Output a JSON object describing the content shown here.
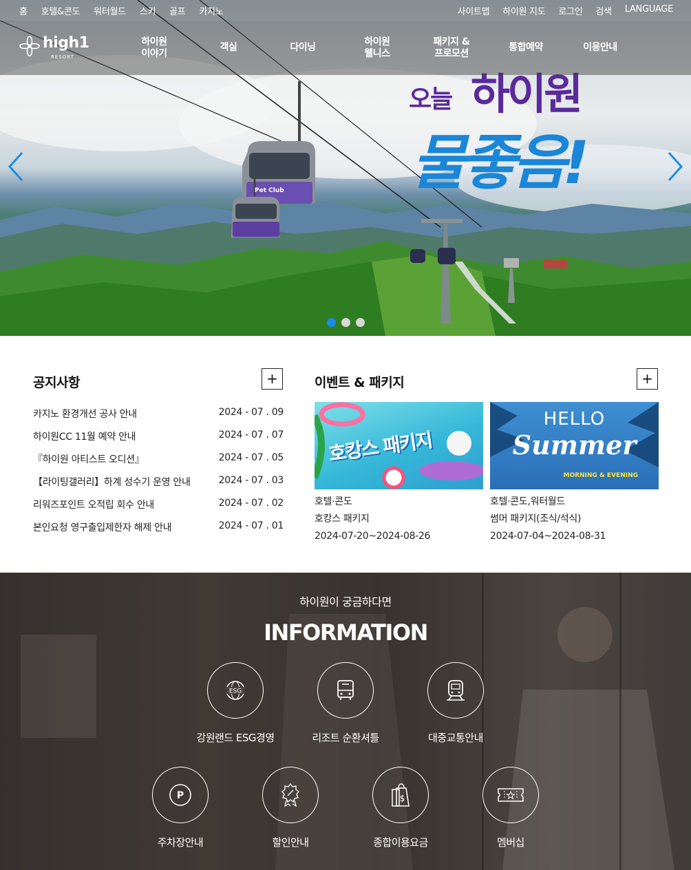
{
  "topbar": {
    "left": [
      "홈",
      "호텔&콘도",
      "워터월드",
      "스키",
      "골프",
      "카지노"
    ],
    "right": [
      "사이트맵",
      "하이원 지도",
      "로그인",
      "검색",
      "LANGUAGE"
    ]
  },
  "logo": {
    "word": "high1",
    "sub": "RESORT"
  },
  "nav": [
    "하이원\n이야기",
    "객실",
    "다이닝",
    "하이원\n웰니스",
    "패키지 &\n프로모션",
    "통합예약",
    "이용안내"
  ],
  "hero": {
    "headline_small": "오늘",
    "headline_top": "하이원",
    "headline_main": "물좋음!",
    "gondola_label": "Pet Club",
    "slides": 3,
    "active_slide": 1,
    "colors": {
      "purple": "#5a2a9c",
      "blue": "#1a86d8",
      "dot_active": "#1a8ce6"
    }
  },
  "notice": {
    "title": "공지사항",
    "more": "+",
    "items": [
      {
        "title": "카지노 환경개선 공사 안내",
        "date": "2024 - 07 . 09"
      },
      {
        "title": "하이원CC 11월 예약 안내",
        "date": "2024 - 07 . 07"
      },
      {
        "title": "『하이원 아티스트 오디션』",
        "date": "2024 - 07 . 05"
      },
      {
        "title": "【라이팅갤러리】하계 성수기 운영 안내",
        "date": "2024 - 07 . 03"
      },
      {
        "title": "리워즈포인트 오적립 회수 안내",
        "date": "2024 - 07 . 02"
      },
      {
        "title": "본인요청 영구출입제한자 해제 안내",
        "date": "2024 - 07 . 01"
      }
    ]
  },
  "events": {
    "title": "이벤트 & 패키지",
    "more": "+",
    "items": [
      {
        "category": "호텔·콘도",
        "name": "호캉스 패키지",
        "period": "2024-07-20~2024-08-26",
        "thumb_text": "호캉스 패키지"
      },
      {
        "category": "호텔·콘도,워터월드",
        "name": "썸머 패키지(조식/석식)",
        "period": "2024-07-04~2024-08-31",
        "thumb_text_top": "HELLO",
        "thumb_text_main": "Summer",
        "thumb_text_sub": "MORNING & EVENING"
      }
    ]
  },
  "info": {
    "subtitle": "하이원이 궁금하다면",
    "title": "INFORMATION",
    "items": [
      {
        "label": "강원랜드 ESG경영",
        "icon": "esg-globe-icon",
        "icon_text": "ESG"
      },
      {
        "label": "리조트 순환셔틀",
        "icon": "bus-icon"
      },
      {
        "label": "대중교통안내",
        "icon": "train-icon"
      },
      {
        "label": "주차장안내",
        "icon": "parking-icon",
        "icon_text": "P"
      },
      {
        "label": "할인안내",
        "icon": "discount-badge-icon"
      },
      {
        "label": "종합이용요금",
        "icon": "price-tag-icon",
        "icon_text": "$"
      },
      {
        "label": "멤버십",
        "icon": "membership-ticket-icon"
      }
    ]
  }
}
